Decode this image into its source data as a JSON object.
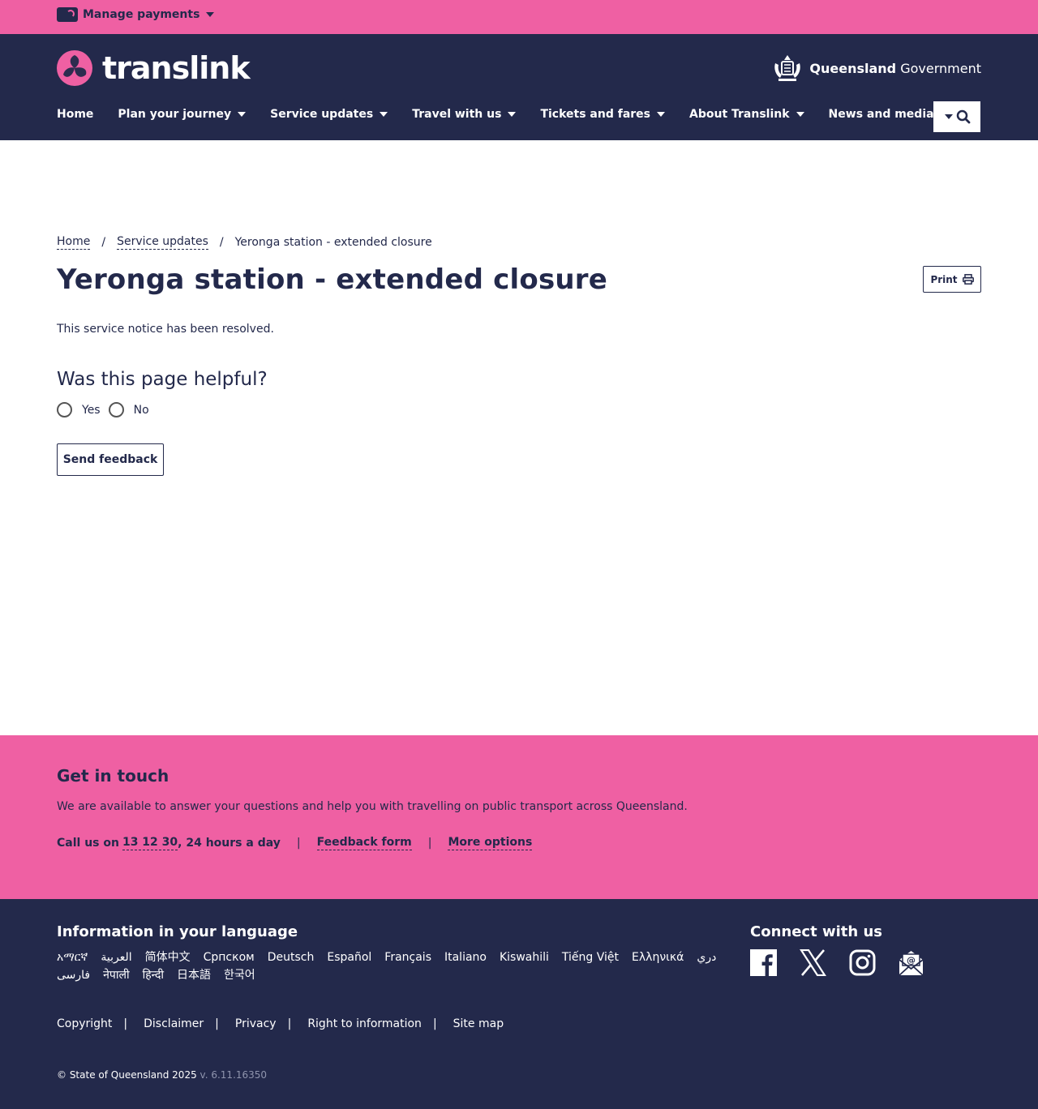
{
  "topbar": {
    "manage_label": "Manage payments"
  },
  "header": {
    "brand": "translink",
    "gov_bold": "Queensland",
    "gov_light": "Government"
  },
  "nav": [
    {
      "label": "Home"
    },
    {
      "label": "Plan your journey"
    },
    {
      "label": "Service updates"
    },
    {
      "label": "Travel with us"
    },
    {
      "label": "Tickets and fares"
    },
    {
      "label": "About Translink"
    },
    {
      "label": "News and media"
    }
  ],
  "breadcrumb": {
    "home": "Home",
    "service_updates": "Service updates",
    "current": "Yeronga station - extended closure",
    "separator": "/"
  },
  "page": {
    "title": "Yeronga station - extended closure",
    "print_label": "Print",
    "notice": "This service notice has been resolved.",
    "helpful_heading": "Was this page helpful?",
    "yes_label": "Yes",
    "no_label": "No",
    "send_label": "Send feedback"
  },
  "touch": {
    "heading": "Get in touch",
    "text": "We are available to answer your questions and help you with travelling on public transport across Queensland.",
    "call_prefix": "Call us on",
    "phone": "13 12 30",
    "call_suffix": ", 24 hours a day",
    "feedback": "Feedback form",
    "more": "More options",
    "pipe": "|"
  },
  "footer": {
    "lang_heading": "Information in your language",
    "languages": [
      "አማርኛ",
      "العربية",
      "简体中文",
      "Српском",
      "Deutsch",
      "Español",
      "Français",
      "Italiano",
      "Kiswahili",
      "Tiếng Việt",
      "Ελληνικά",
      "دري",
      "فارسی",
      "नेपाली",
      "हिन्दी",
      "日本語",
      "한국어"
    ],
    "connect_heading": "Connect with us",
    "legal": [
      "Copyright",
      "Disclaimer",
      "Privacy",
      "Right to information",
      "Site map"
    ],
    "copyright": "© State of Queensland 2025",
    "version": "v. 6.11.16350"
  },
  "colors": {
    "pink": "#ef60a3",
    "navy": "#23294b"
  },
  "icons": [
    "card-icon",
    "chevron-down-icon",
    "search-icon",
    "printer-icon",
    "facebook-icon",
    "x-icon",
    "instagram-icon",
    "email-icon"
  ]
}
